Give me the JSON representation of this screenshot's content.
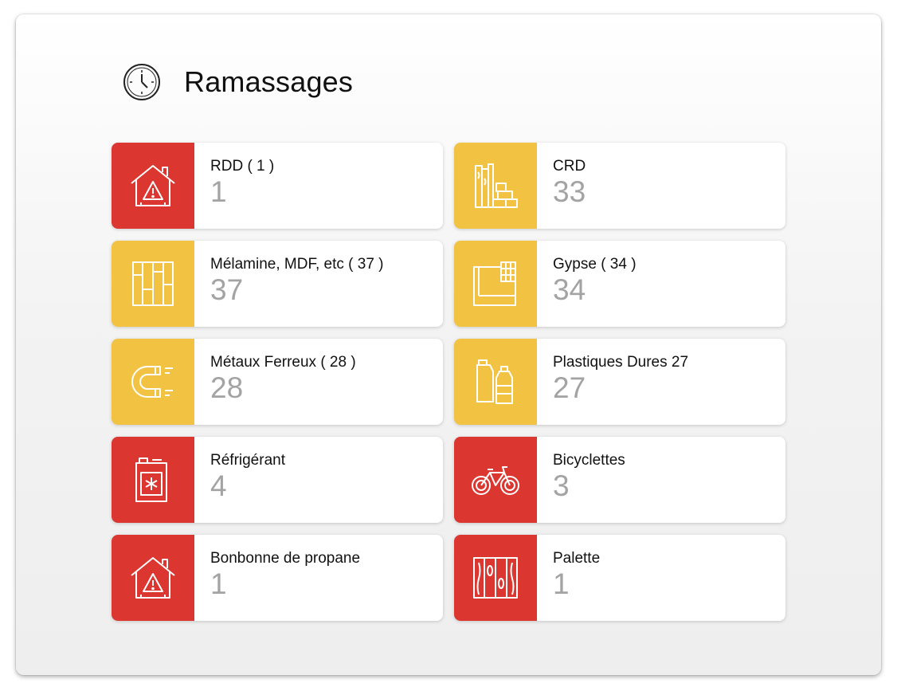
{
  "page": {
    "title": "Ramassages",
    "icon": "clock-icon"
  },
  "colors": {
    "red": "#db3630",
    "yellow": "#f2c242"
  },
  "cards": [
    {
      "label": "RDD ( 1 )",
      "count": "1",
      "icon": "hazard-house-icon",
      "color": "red"
    },
    {
      "label": "CRD",
      "count": "33",
      "icon": "bricks-wood-icon",
      "color": "yellow"
    },
    {
      "label": "Mélamine, MDF, etc ( 37 )",
      "count": "37",
      "icon": "wood-panels-icon",
      "color": "yellow"
    },
    {
      "label": "Gypse ( 34 )",
      "count": "34",
      "icon": "drywall-icon",
      "color": "yellow"
    },
    {
      "label": "Métaux Ferreux ( 28 )",
      "count": "28",
      "icon": "magnet-icon",
      "color": "yellow"
    },
    {
      "label": "Plastiques Dures 27",
      "count": "27",
      "icon": "plastic-bottles-icon",
      "color": "yellow"
    },
    {
      "label": "Réfrigérant",
      "count": "4",
      "icon": "refrigerant-jerrycan-icon",
      "color": "red"
    },
    {
      "label": "Bicyclettes",
      "count": "3",
      "icon": "bicycle-icon",
      "color": "red"
    },
    {
      "label": "Bonbonne de propane",
      "count": "1",
      "icon": "hazard-house-icon",
      "color": "red"
    },
    {
      "label": "Palette",
      "count": "1",
      "icon": "wood-pallet-icon",
      "color": "red"
    }
  ]
}
